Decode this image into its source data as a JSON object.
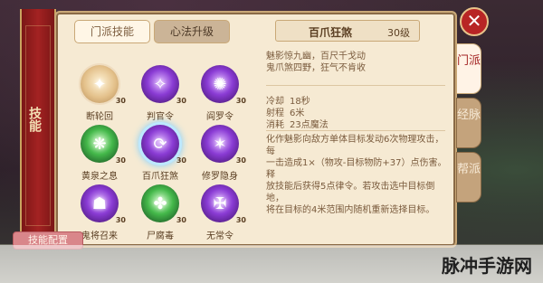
{
  "banner": {
    "title": "技能"
  },
  "tabs": {
    "menpai": "门派技能",
    "xinfa": "心法升级"
  },
  "skills": [
    {
      "name": "断轮回",
      "level": "30",
      "icon": "gold-blade-icon"
    },
    {
      "name": "判官令",
      "level": "30",
      "icon": "purple-talisman-icon"
    },
    {
      "name": "阎罗令",
      "level": "30",
      "icon": "purple-flame-icon"
    },
    {
      "name": "黄泉之息",
      "level": "30",
      "icon": "green-mist-icon"
    },
    {
      "name": "百爪狂煞",
      "level": "30",
      "icon": "purple-vortex-icon"
    },
    {
      "name": "修罗隐身",
      "level": "30",
      "icon": "purple-cloak-icon"
    },
    {
      "name": "鬼将召来",
      "level": "30",
      "icon": "purple-ghost-icon"
    },
    {
      "name": "尸腐毒",
      "level": "30",
      "icon": "green-poison-icon"
    },
    {
      "name": "无常令",
      "level": "30",
      "icon": "purple-token-icon"
    }
  ],
  "config_button": "技能配置",
  "detail": {
    "name": "百爪狂煞",
    "level": "30级",
    "desc_line1": "魅影惊九幽，百尺千戈动",
    "desc_line2": "鬼爪煞四野，狂气不肯收",
    "cooldown_label": "冷却",
    "cooldown_value": "18秒",
    "range_label": "射程",
    "range_value": "6米",
    "cost_label": "消耗",
    "cost_value": "23点魔法",
    "effect_line1": "化作魅影向敌方单体目标发动6次物理攻击，每",
    "effect_line2": "一击造成1×（物攻-目标物防+37）点伤害。释",
    "effect_line3": "放技能后获得5点律令。若攻击选中目标倒地，",
    "effect_line4": "将在目标的4米范围内随机重新选择目标。"
  },
  "side_tabs": {
    "menpai": "门派",
    "jingmai": "经脉",
    "bangpai": "帮派"
  },
  "close_symbol": "✕",
  "watermark": "脉冲手游网"
}
